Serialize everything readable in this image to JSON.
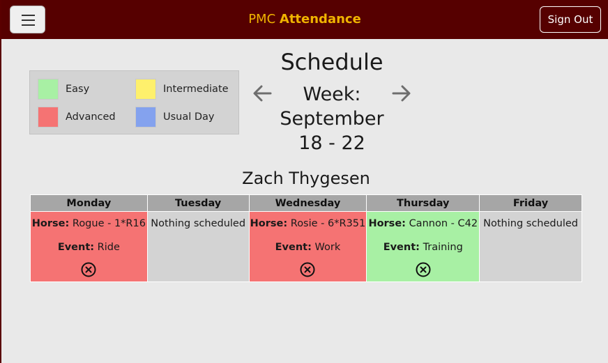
{
  "header": {
    "brand_prefix": "PMC",
    "brand_strong": "Attendance",
    "signout_label": "Sign Out"
  },
  "legend": {
    "items": [
      {
        "label": "Easy",
        "color": "#a8f0a4"
      },
      {
        "label": "Intermediate",
        "color": "#fef06c"
      },
      {
        "label": "Advanced",
        "color": "#f57373"
      },
      {
        "label": "Usual Day",
        "color": "#84a2ee"
      }
    ]
  },
  "schedule": {
    "title": "Schedule",
    "week_line1": "Week:",
    "week_line2": "September",
    "week_line3": "18 - 22",
    "person": "Zach Thygesen"
  },
  "table": {
    "days": [
      "Monday",
      "Tuesday",
      "Wednesday",
      "Thursday",
      "Friday"
    ],
    "horse_label": "Horse:",
    "event_label": "Event:",
    "cells": [
      {
        "horse": "Rogue - 1*R16",
        "event": "Ride",
        "color": "#f57373"
      },
      {
        "empty": "Nothing scheduled",
        "color": "#d3d3d3"
      },
      {
        "horse": "Rosie - 6*R351",
        "event": "Work",
        "color": "#f57373"
      },
      {
        "horse": "Cannon - C42",
        "event": "Training",
        "color": "#a8f0a4"
      },
      {
        "empty": "Nothing scheduled",
        "color": "#d3d3d3"
      }
    ]
  }
}
